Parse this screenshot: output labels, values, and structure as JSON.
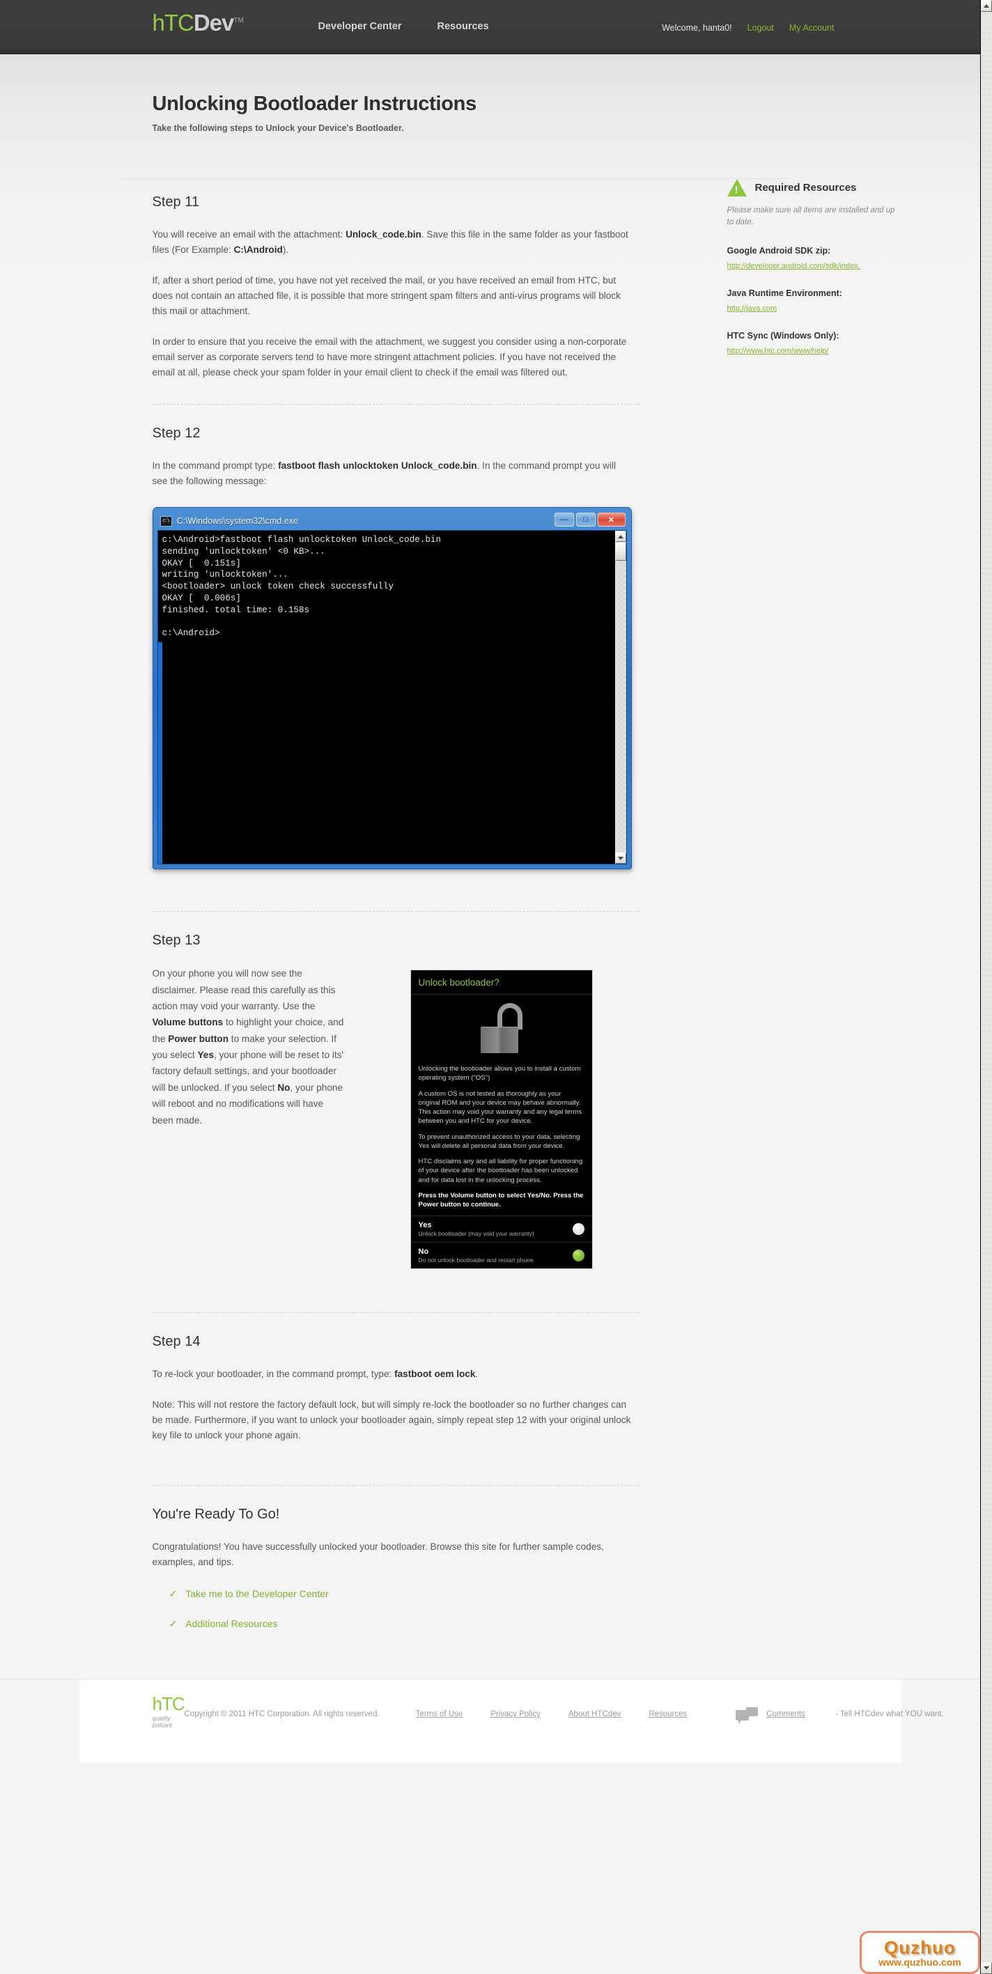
{
  "nav": {
    "logo_htc": "hTC",
    "logo_dev": "Dev",
    "logo_tm": "TM",
    "developer_center": "Developer Center",
    "resources": "Resources",
    "welcome": "Welcome, hanta0!",
    "logout": "Logout",
    "my_account": "My Account"
  },
  "header": {
    "title": "Unlocking Bootloader Instructions",
    "subtitle": "Take the following steps to Unlock your Device's Bootloader."
  },
  "steps": {
    "step11": {
      "title": "Step 11",
      "p1_a": "You will receive an email with the attachment: ",
      "p1_b": "Unlock_code.bin",
      "p1_c": ". Save this file in the same folder as your fastboot files (For Example: ",
      "p1_d": "C:\\Android",
      "p1_e": ").",
      "p2": "If, after a short period of time, you have not yet received the mail, or you have received an email from HTC, but does not contain an attached file, it is possible that more stringent spam filters and anti-virus programs will block this mail or attachment.",
      "p3": "In order to ensure that you receive the email with the attachment, we suggest you consider using a non-corporate email server as corporate servers tend to have more stringent attachment policies. If you have not received the email at all, please check your spam folder in your email client to check if the email was filtered out."
    },
    "step12": {
      "title": "Step 12",
      "p1_a": "In the command prompt type: ",
      "p1_b": "fastboot flash unlocktoken Unlock_code.bin",
      "p1_c": ". In the command prompt you will see the following message:"
    },
    "step13": {
      "title": "Step 13",
      "p1_a": "On your phone you will now see the disclaimer. Please read this carefully as this action may void your warranty. Use the ",
      "p1_b": "Volume buttons",
      "p1_c": " to highlight your choice, and the ",
      "p1_d": "Power button",
      "p1_e": " to make your selection. If you select ",
      "p1_f": "Yes",
      "p1_g": ", your phone will be reset to its' factory default settings, and your bootloader will be unlocked. If you select ",
      "p1_h": "No",
      "p1_i": ", your phone will reboot and no modifications will have been made."
    },
    "step14": {
      "title": "Step 14",
      "p1_a": "To re-lock your bootloader, in the command prompt, type: ",
      "p1_b": "fastboot oem lock",
      "p1_c": ".",
      "p2": "Note: This will not restore the factory default lock, but will simply re-lock the bootloader so no further changes can be made. Furthermore, if you want to unlock your bootloader again, simply repeat step 12 with your original unlock key file to unlock your phone again."
    }
  },
  "sidebar": {
    "title": "Required Resources",
    "note": "Please make sure all items are installed and up to date.",
    "items": [
      {
        "label": "Google Android SDK zip:",
        "link": "http://developer.android.com/sdk/index."
      },
      {
        "label": "Java Runtime Environment:",
        "link": "http://java.com"
      },
      {
        "label": "HTC Sync (Windows Only):",
        "link": "http://www.htc.com/www/help/"
      }
    ]
  },
  "cmd_window": {
    "icon_label": "c:\\",
    "title": "C:\\Windows\\system32\\cmd.exe",
    "minimize": "—",
    "maximize": "□",
    "close": "✕",
    "output": "c:\\Android>fastboot flash unlocktoken Unlock_code.bin\nsending 'unlocktoken' <0 KB>...\nOKAY [  0.151s]\nwriting 'unlocktoken'...\n<bootloader> unlock token check successfully\nOKAY [  0.006s]\nfinished. total time: 0.158s\n\nc:\\Android>"
  },
  "phone_screen": {
    "heading": "Unlock bootloader?",
    "lock_icon": "open-padlock-icon",
    "paragraphs": [
      "Unlocking the bootloader allows you to  install a custom operating system (\"OS\")",
      "A custom OS is not tested as thoroughly as your original ROM and your device may behave abnormally. This action may void your warranty and any legal terms between you and HTC for your device.",
      "To prevent unauthorized access to your data, selecting Yes will delete all personal data from your device.",
      "HTC disclaims any and all liability for proper functioning of your device after the bootloader has been unlocked and for data lost in the unlocking process."
    ],
    "instruction": "Press the Volume button to select Yes/No. Press the Power button to continue.",
    "choices": [
      {
        "title": "Yes",
        "desc": "Unlock bootloader (may void your warranty)",
        "selected": false
      },
      {
        "title": "No",
        "desc": "Do not unlock bootloader and restart phone",
        "selected": true
      }
    ]
  },
  "ready": {
    "title": "You're Ready To Go!",
    "body": "Congratulations! You have successfully unlocked your bootloader. Browse this site for further sample codes, examples, and tips.",
    "check": "✓",
    "links": [
      "Take me to the Developer Center",
      "Additional Resources"
    ]
  },
  "footer": {
    "logo": "hTC",
    "tagline": "quietly brilliant",
    "copyright": "Copyright © 2011 HTC Corporation. All rights reserved.",
    "links": [
      "Terms of Use",
      "Privacy Policy",
      "About HTCdev",
      "Resources"
    ],
    "comments_icon": "speech-bubbles-icon",
    "comments_link": "Comments",
    "comments_tail": " - Tell HTCdev what YOU want."
  },
  "watermark": {
    "big": "Quzhuo",
    "small": "www.quzhuo.com"
  },
  "scrollbar": {
    "up_arrow": "▲",
    "down_arrow": "▼"
  },
  "colors": {
    "brand_green": "#8dc63f",
    "nav_dark": "#3d3d3d",
    "link_green": "#7fb22e",
    "watermark_orange": "#e08214"
  }
}
